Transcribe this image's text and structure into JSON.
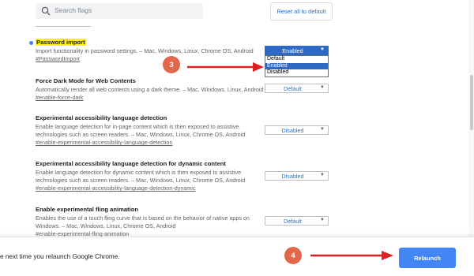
{
  "search": {
    "placeholder": "Search flags"
  },
  "header": {
    "reset_label": "Reset all to default"
  },
  "flags": [
    {
      "title": "Password import",
      "description": "Import functionality in password settings. – Mac, Windows, Linux, Chrome OS, Android",
      "link": "#PasswordImport",
      "value": "Enabled",
      "options": [
        "Default",
        "Enabled",
        "Disabled"
      ],
      "highlighted_option": "Enabled"
    },
    {
      "title": "Force Dark Mode for Web Contents",
      "description": "Automatically render all web contents using a dark theme. – Mac, Windows, Linux, Android",
      "link": "#enable-force-dark",
      "value": "Default"
    },
    {
      "title": "Experimental accessibility language detection",
      "description": "Enable language detection for in-page content which is then exposed to assistive technologies such as screen readers. – Mac, Windows, Linux, Chrome OS, Android",
      "link": "#enable-experimental-accessibility-language-detection",
      "value": "Disabled"
    },
    {
      "title": "Experimental accessibility language detection for dynamic content",
      "description": "Enable language detection for dynamic content which is then exposed to assistive technologies such as screen readers. – Mac, Windows, Linux, Chrome OS, Android",
      "link": "#enable-experimental-accessibility-language-detection-dynamic",
      "value": "Disabled"
    },
    {
      "title": "Enable experimental fling animation",
      "description": "Enables the use of a touch fling curve that is based on the behavior of native apps on Windows. – Mac, Windows, Linux, Chrome OS, Android",
      "link": "#enable-experimental-fling-animation",
      "value": "Default"
    }
  ],
  "annotations": {
    "step3": "3",
    "step4": "4"
  },
  "footer": {
    "relaunch_message": "e next time you relaunch Google Chrome.",
    "relaunch_label": "Relaunch"
  },
  "colors": {
    "accent": "#1a73e8",
    "annotation": "#e2664a",
    "arrow": "#e02020",
    "highlight": "#fff200"
  },
  "icons": {
    "search": "search-icon",
    "caret": "chevron-down-icon",
    "status_dot": "modified-dot-icon"
  }
}
